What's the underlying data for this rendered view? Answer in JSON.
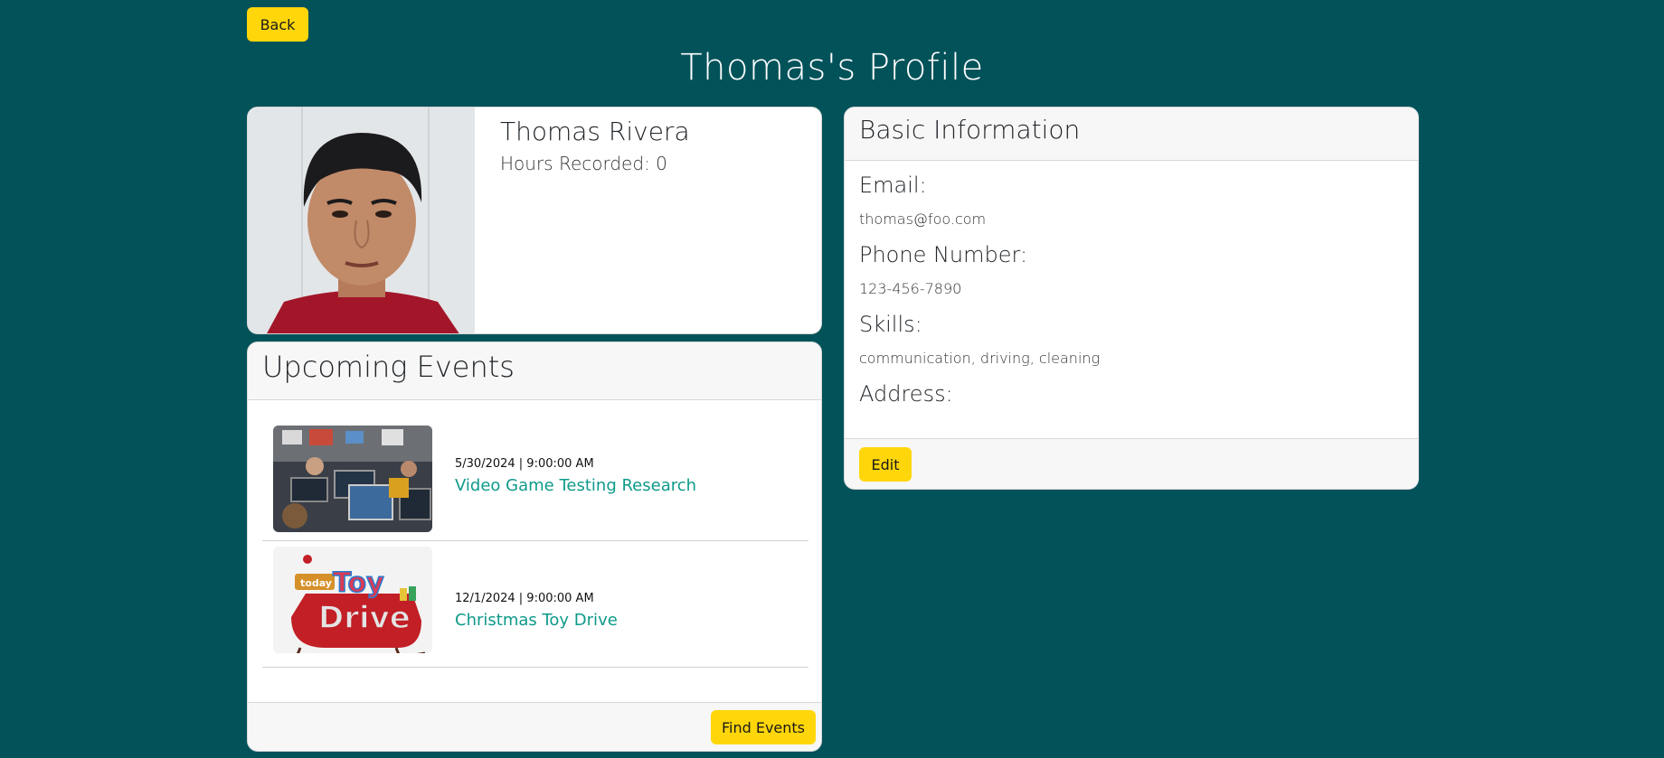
{
  "nav": {
    "back_label": "Back"
  },
  "page": {
    "title": "Thomas's Profile"
  },
  "profile": {
    "name": "Thomas Rivera",
    "hours_label": "Hours Recorded: 0"
  },
  "basic_info": {
    "title": "Basic Information",
    "email_label": "Email:",
    "email_value": "thomas@foo.com",
    "phone_label": "Phone Number:",
    "phone_value": "123-456-7890",
    "skills_label": "Skills:",
    "skills_value": "communication, driving, cleaning",
    "address_label": "Address:",
    "edit_label": "Edit"
  },
  "events": {
    "title": "Upcoming Events",
    "items": [
      {
        "date": "5/30/2024 | 9:00:00 AM",
        "title": "Video Game Testing Research"
      },
      {
        "date": "12/1/2024 | 9:00:00 AM",
        "title": "Christmas Toy Drive"
      }
    ],
    "find_label": "Find Events"
  },
  "colors": {
    "background": "#02525a",
    "accent_button": "#ffd60a",
    "link": "#0e9a8a"
  }
}
